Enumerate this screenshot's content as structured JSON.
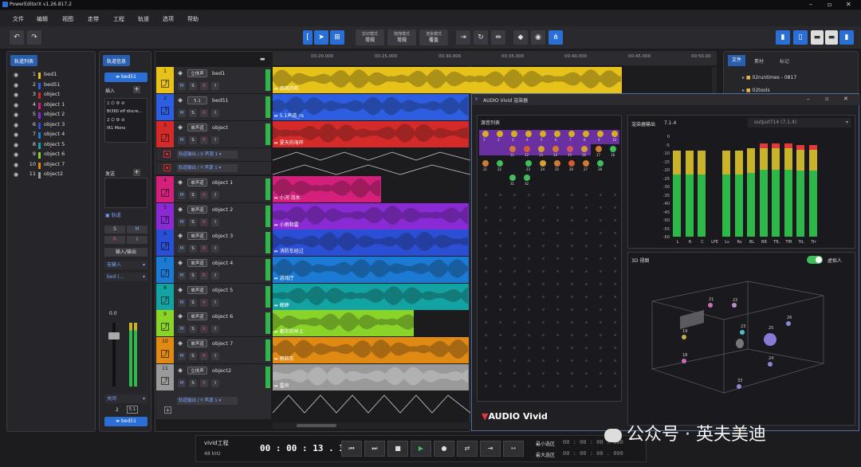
{
  "app": {
    "title": "PowerEditorX v1.26.817.2"
  },
  "menu": [
    "文件",
    "编辑",
    "视图",
    "走带",
    "工程",
    "轨道",
    "选项",
    "帮助"
  ],
  "toolbar": {
    "modes": [
      {
        "top": "剪切模式",
        "value": "常规"
      },
      {
        "top": "拖拽模式",
        "value": "常规"
      },
      {
        "top": "渲染模式",
        "value": "覆盖"
      }
    ]
  },
  "track_list": {
    "title": "轨道列表",
    "items": [
      {
        "num": "1",
        "name": "bed1",
        "color": "#e6c21a"
      },
      {
        "num": "2",
        "name": "bed51",
        "color": "#2d5de0"
      },
      {
        "num": "3",
        "name": "object",
        "color": "#d42a2a"
      },
      {
        "num": "4",
        "name": "object 1",
        "color": "#d4207a"
      },
      {
        "num": "5",
        "name": "object 2",
        "color": "#8a2ad4"
      },
      {
        "num": "6",
        "name": "object 3",
        "color": "#2a4fd4"
      },
      {
        "num": "7",
        "name": "object 4",
        "color": "#1a7ad4"
      },
      {
        "num": "8",
        "name": "object 5",
        "color": "#14a3a3"
      },
      {
        "num": "9",
        "name": "object 6",
        "color": "#8ad42a"
      },
      {
        "num": "10",
        "name": "object 7",
        "color": "#e08a14"
      },
      {
        "num": "11",
        "name": "object2",
        "color": "#9a9a9a"
      }
    ]
  },
  "track_info": {
    "title": "轨道信息",
    "track_button": "bed51",
    "insert_label": "插入",
    "plugin_name": "Bt360 eff discre...",
    "plugin_sub": "IR1 Mono",
    "send_label": "发送",
    "track_label": "轨道",
    "s": "S",
    "m": "M",
    "r": "R",
    "i": "I",
    "io_label": "输入/输出",
    "input": "无输入",
    "output": "bed (...",
    "volume": "0.0",
    "auto": "关闭",
    "channels_num": "2",
    "channels_fmt": "5.1",
    "bottom_button": "bed51"
  },
  "tracks": [
    {
      "num": "1",
      "chip": "立体声",
      "name": "bed1",
      "color": "#e6c21a",
      "clip": ""
    },
    {
      "num": "2",
      "chip": "5.1",
      "name": "bed51",
      "color": "#2d5de0",
      "clip": "5.1声道_rs"
    },
    {
      "num": "3",
      "chip": "单声道",
      "name": "object",
      "color": "#d42a2a",
      "clip": "夏天的海岸"
    },
    {
      "num": "4",
      "chip": "单声道",
      "name": "object 1",
      "color": "#d4207a",
      "clip": "小河·流水"
    },
    {
      "num": "5",
      "chip": "单声道",
      "name": "object 2",
      "color": "#8a2ad4",
      "clip": "小雨和雷"
    },
    {
      "num": "6",
      "chip": "单声道",
      "name": "object 3",
      "color": "#2a4fd4",
      "clip": "消防车经过"
    },
    {
      "num": "7",
      "chip": "单声道",
      "name": "object 4",
      "color": "#1a7ad4",
      "clip": "游戏厅"
    },
    {
      "num": "8",
      "chip": "单声道",
      "name": "object 5",
      "color": "#14a3a3",
      "clip": "蟋蟀"
    },
    {
      "num": "9",
      "chip": "单声道",
      "name": "object 6",
      "color": "#8ad42a",
      "clip": "都市的早上"
    },
    {
      "num": "10",
      "chip": "单声道",
      "name": "object 7",
      "color": "#e08a14",
      "clip": "雨和车"
    },
    {
      "num": "11",
      "chip": "立体声",
      "name": "object2",
      "color": "#9a9a9a",
      "clip": "雷声"
    }
  ],
  "first_clip": "西风的吼",
  "automation": {
    "x": "轨道输出 / X 声源 1",
    "y": "轨道输出 / Y 声源 1",
    "y2": "轨道输出 / Y 声源 1"
  },
  "ruler": [
    "00:20.000",
    "00:25.000",
    "00:30.000",
    "00:35.000",
    "00:40.000",
    "00:45.000",
    "00:50.00"
  ],
  "right_panel": {
    "tabs": [
      "文件",
      "素材",
      "标记"
    ],
    "items": [
      "02runtimes - 0817",
      "02tools"
    ]
  },
  "vivid_window": {
    "title": "AUDIO Vivid 渲染器",
    "sources_title": "源音列表",
    "meter_title": "渲染器输出",
    "meter_format": "7.1.4",
    "output_select": "output714 (7.1.4)",
    "scale": [
      "0",
      "-5",
      "-10",
      "-15",
      "-20",
      "-25",
      "-30",
      "-35",
      "-40",
      "-45",
      "-50",
      "-55",
      "-60"
    ],
    "channels": [
      "L",
      "R",
      "C",
      "LFE",
      "Ls",
      "Rs",
      "BL",
      "BR",
      "TfL",
      "TfR",
      "TrL",
      "Trr"
    ],
    "channel_levels": [
      0.86,
      0.86,
      0.86,
      0.0,
      0.86,
      0.86,
      0.88,
      0.93,
      0.93,
      0.93,
      0.91,
      0.91
    ],
    "view3d_title": "3D 视图",
    "virtual_label": "虚拟人",
    "logo": "AUDIO Vivid",
    "source_row1": [
      "1",
      "2",
      "3",
      "4",
      "5",
      "6",
      "7",
      "8",
      "9",
      "10"
    ],
    "source_row2": [
      "11",
      "12",
      "13",
      "14",
      "15",
      "16",
      "17",
      "18"
    ],
    "source_row3": [
      "21",
      "22",
      "23",
      "24",
      "25",
      "26",
      "27",
      "28"
    ],
    "source_row4": [
      "31",
      "32"
    ],
    "space_labels": [
      "21",
      "22",
      "26",
      "25",
      "23",
      "24",
      "33",
      "18",
      "19"
    ]
  },
  "transport": {
    "project": "vivid工程",
    "rate": "48 kHz",
    "time": "00 : 00 : 13 . 393",
    "min_label": "最小选区",
    "max_label": "最大选区",
    "min_value": "00 : 00 : 00 . 000",
    "max_value": "00 : 00 : 00 . 000"
  },
  "watermark": "公众号 · 英夫美迪"
}
